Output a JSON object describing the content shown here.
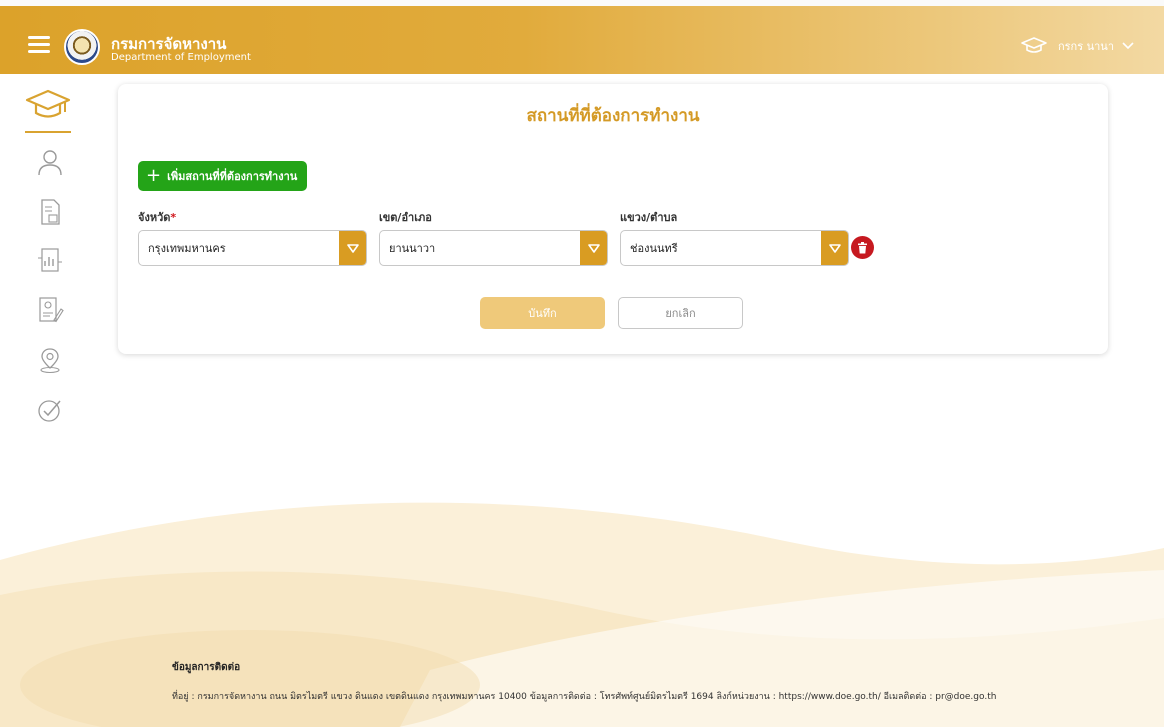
{
  "header": {
    "org_name_th": "กรมการจัดหางาน",
    "org_name_en": "Department of Employment",
    "user_name": "กรกร นานา"
  },
  "sidebar": {
    "items": [
      {
        "icon": "graduation-cap-icon",
        "active": true
      },
      {
        "icon": "user-icon",
        "active": false
      },
      {
        "icon": "document-icon",
        "active": false
      },
      {
        "icon": "resume-chart-icon",
        "active": false
      },
      {
        "icon": "profile-edit-icon",
        "active": false
      },
      {
        "icon": "location-pin-icon",
        "active": false
      },
      {
        "icon": "check-circle-icon",
        "active": false
      }
    ]
  },
  "card": {
    "title": "สถานที่ที่ต้องการทำงาน",
    "add_button_label": "เพิ่มสถานที่ที่ต้องการทำงาน",
    "fields": {
      "province": {
        "label": "จังหวัด",
        "required_mark": "*",
        "value": "กรุงเทพมหานคร"
      },
      "district": {
        "label": "เขต/อำเภอ",
        "value": "ยานนาวา"
      },
      "subdistrict": {
        "label": "แขวง/ตำบล",
        "value": "ช่องนนทรี"
      }
    },
    "save_label": "บันทึก",
    "cancel_label": "ยกเลิก"
  },
  "footer": {
    "title": "ข้อมูลการติดต่อ",
    "address": "ที่อยู่ : กรมการจัดหางาน ถนน มิตรไมตรี แขวง ดินแดง เขตดินแดง กรุงเทพมหานคร 10400 ข้อมูลการติดต่อ : โทรศัพท์ศูนย์มิตรไมตรี 1694 ลิงก์หน่วยงาน : https://www.doe.go.th/ อีเมลติดต่อ : pr@doe.go.th"
  },
  "colors": {
    "brand": "#dca22a",
    "title": "#d49a26",
    "add_button": "#24a418",
    "delete": "#c61920",
    "save_disabled": "#efc97a"
  }
}
